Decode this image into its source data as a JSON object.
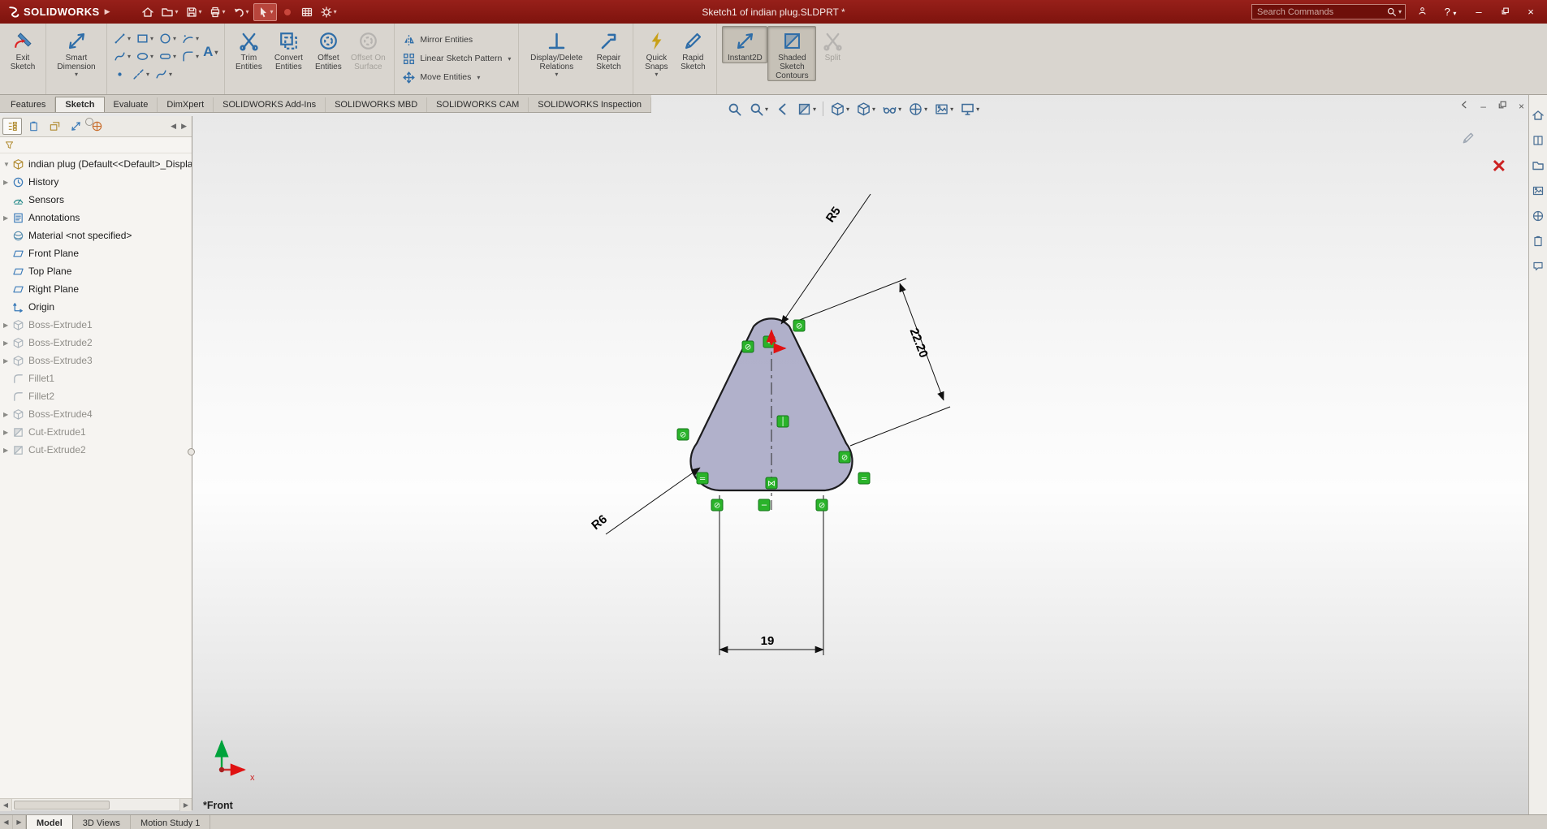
{
  "titlebar": {
    "logo": "SOLIDWORKS",
    "title": "Sketch1 of indian plug.SLDPRT *",
    "search_placeholder": "Search Commands",
    "help_label": "?"
  },
  "ribbon": {
    "exit_sketch": "Exit Sketch",
    "smart_dimension": "Smart Dimension",
    "trim": "Trim Entities",
    "convert": "Convert Entities",
    "offset": "Offset Entities",
    "offset_surface": "Offset On Surface",
    "mirror": "Mirror Entities",
    "linear_pattern": "Linear Sketch Pattern",
    "move": "Move Entities",
    "display_delete": "Display/Delete Relations",
    "repair": "Repair Sketch",
    "quick_snaps": "Quick Snaps",
    "rapid_sketch": "Rapid Sketch",
    "instant2d": "Instant2D",
    "shaded": "Shaded Sketch Contours",
    "split": "Split"
  },
  "command_tabs": [
    {
      "label": "Features"
    },
    {
      "label": "Sketch",
      "active": true
    },
    {
      "label": "Evaluate"
    },
    {
      "label": "DimXpert"
    },
    {
      "label": "SOLIDWORKS Add-Ins"
    },
    {
      "label": "SOLIDWORKS MBD"
    },
    {
      "label": "SOLIDWORKS CAM"
    },
    {
      "label": "SOLIDWORKS Inspection"
    }
  ],
  "feature_tree": {
    "root": "indian plug  (Default<<Default>_Display",
    "items": [
      {
        "label": "History",
        "expand": true
      },
      {
        "label": "Sensors"
      },
      {
        "label": "Annotations",
        "expand": true
      },
      {
        "label": "Material <not specified>"
      },
      {
        "label": "Front Plane"
      },
      {
        "label": "Top Plane"
      },
      {
        "label": "Right Plane"
      },
      {
        "label": "Origin"
      },
      {
        "label": "Boss-Extrude1",
        "expand": true,
        "grayed": true
      },
      {
        "label": "Boss-Extrude2",
        "expand": true,
        "grayed": true
      },
      {
        "label": "Boss-Extrude3",
        "expand": true,
        "grayed": true
      },
      {
        "label": "Fillet1",
        "grayed": true
      },
      {
        "label": "Fillet2",
        "grayed": true
      },
      {
        "label": "Boss-Extrude4",
        "expand": true,
        "grayed": true
      },
      {
        "label": "Cut-Extrude1",
        "expand": true,
        "grayed": true
      },
      {
        "label": "Cut-Extrude2",
        "expand": true,
        "grayed": true
      }
    ]
  },
  "sketch": {
    "view_label": "*Front",
    "dimensions": {
      "top_radius": "R5",
      "side_length": "22.20",
      "bottom_radius": "R6",
      "bottom_width": "19"
    },
    "relations": [
      {
        "type": "tangent",
        "glyph": "⊘"
      },
      {
        "type": "tangent",
        "glyph": "⊘"
      },
      {
        "type": "coincident",
        "glyph": "•"
      },
      {
        "type": "tangent",
        "glyph": "⊘"
      },
      {
        "type": "vertical",
        "glyph": "│"
      },
      {
        "type": "tangent",
        "glyph": "⊘"
      },
      {
        "type": "equal",
        "glyph": "="
      },
      {
        "type": "equal",
        "glyph": "="
      },
      {
        "type": "tangent",
        "glyph": "⊘"
      },
      {
        "type": "tangent",
        "glyph": "⊘"
      },
      {
        "type": "symmetric",
        "glyph": "⋈"
      },
      {
        "type": "horizontal",
        "glyph": "─"
      }
    ],
    "triad": {
      "x_label": "x"
    }
  },
  "bottom_tabs": [
    {
      "label": "Model",
      "active": true
    },
    {
      "label": "3D Views"
    },
    {
      "label": "Motion Study 1"
    }
  ]
}
